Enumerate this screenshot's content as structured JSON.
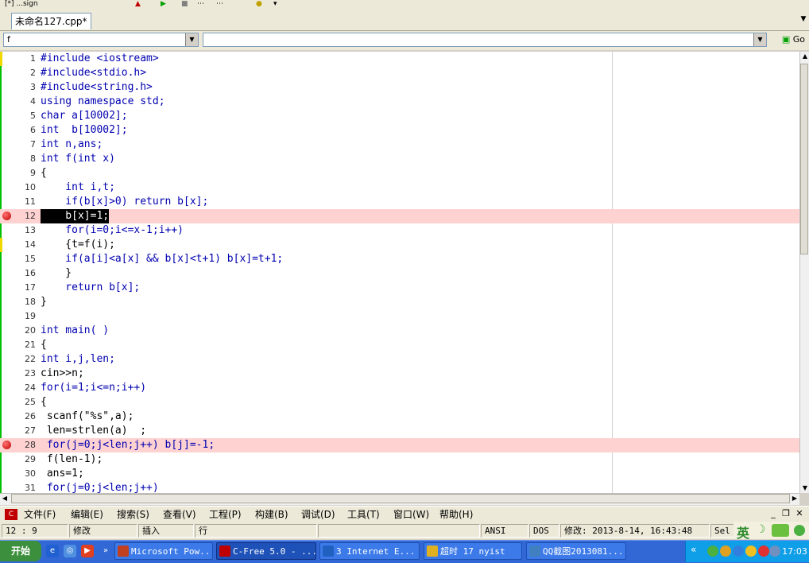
{
  "toolbar": {
    "partial_title": "[*] ...sign"
  },
  "tabs": [
    {
      "label": "未命名127.cpp*"
    }
  ],
  "selectors": {
    "function_value": "f",
    "class_value": "",
    "go_label": "Go"
  },
  "editor": {
    "lines": [
      {
        "n": "1",
        "text": "#include <iostream>"
      },
      {
        "n": "2",
        "text": "#include<stdio.h>"
      },
      {
        "n": "3",
        "text": "#include<string.h>"
      },
      {
        "n": "4",
        "text": "using namespace std;"
      },
      {
        "n": "5",
        "text": "char a[10002];"
      },
      {
        "n": "6",
        "text": "int  b[10002];"
      },
      {
        "n": "7",
        "text": "int n,ans;"
      },
      {
        "n": "8",
        "text": "int f(int x)"
      },
      {
        "n": "9",
        "text": "{"
      },
      {
        "n": "10",
        "text": "    int i,t;"
      },
      {
        "n": "11",
        "text": "    if(b[x]>0) return b[x];"
      },
      {
        "n": "12",
        "text": "    b[x]=1;"
      },
      {
        "n": "13",
        "text": "    for(i=0;i<=x-1;i++)"
      },
      {
        "n": "14",
        "text": "    {t=f(i);"
      },
      {
        "n": "15",
        "text": "    if(a[i]<a[x] && b[x]<t+1) b[x]=t+1;"
      },
      {
        "n": "16",
        "text": "    }"
      },
      {
        "n": "17",
        "text": "    return b[x];"
      },
      {
        "n": "18",
        "text": "}"
      },
      {
        "n": "19",
        "text": ""
      },
      {
        "n": "20",
        "text": "int main( )"
      },
      {
        "n": "21",
        "text": "{"
      },
      {
        "n": "22",
        "text": "int i,j,len;"
      },
      {
        "n": "23",
        "text": "cin>>n;"
      },
      {
        "n": "24",
        "text": "for(i=1;i<=n;i++)"
      },
      {
        "n": "25",
        "text": "{"
      },
      {
        "n": "26",
        "text": " scanf(\"%s\",a);"
      },
      {
        "n": "27",
        "text": " len=strlen(a)  ;"
      },
      {
        "n": "28",
        "text": " for(j=0;j<len;j++) b[j]=-1;"
      },
      {
        "n": "29",
        "text": " f(len-1);"
      },
      {
        "n": "30",
        "text": " ans=1;"
      },
      {
        "n": "31",
        "text": " for(j=0;j<len;j++)"
      }
    ],
    "breakpoint_lines": [
      12,
      28
    ],
    "selected_line": 12
  },
  "menu": {
    "items": [
      "文件(F)",
      "编辑(E)",
      "搜索(S)",
      "查看(V)",
      "工程(P)",
      "构建(B)",
      "调试(D)",
      "工具(T)",
      "窗口(W)",
      "帮助(H)"
    ]
  },
  "status": {
    "position": "12 :  9",
    "modified": "修改",
    "insert": "插入",
    "row": "行",
    "encoding": "ANSI",
    "line_ending": "DOS",
    "modified_time": "修改: 2013-8-14, 16:43:48",
    "sel": "Sel"
  },
  "ime": {
    "label": "英"
  },
  "taskbar": {
    "start_label": "开始",
    "tasks": [
      {
        "label": "Microsoft Pow...",
        "color": "#c04020"
      },
      {
        "label": "C-Free 5.0 - ...",
        "color": "#c00000"
      },
      {
        "label": "3 Internet E...",
        "color": "#2060c0"
      },
      {
        "label": "超时 17 nyist",
        "color": "#e0b020"
      },
      {
        "label": "QQ截图2013081...",
        "color": "#4080c0"
      }
    ],
    "clock": "17:03"
  }
}
